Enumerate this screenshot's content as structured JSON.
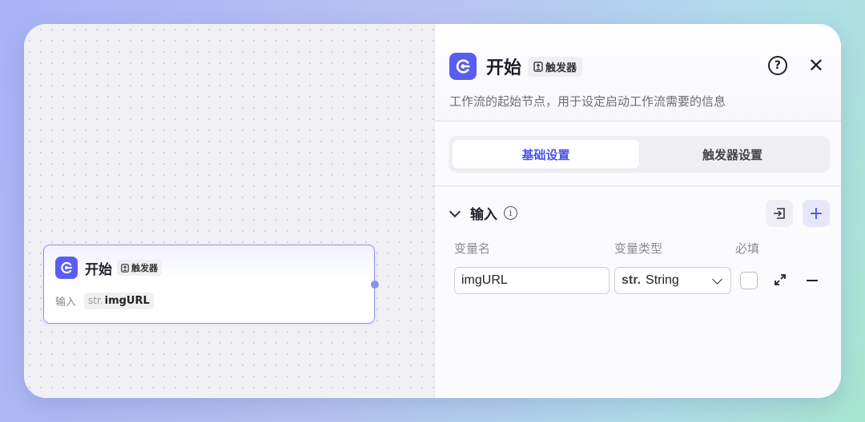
{
  "node": {
    "title": "开始",
    "trigger_tag": "触发器",
    "input_label": "输入",
    "var_prefix": "str.",
    "var_name": "imgURL"
  },
  "panel": {
    "title": "开始",
    "trigger_tag": "触发器",
    "help_icon": "question-circle-icon",
    "close_icon": "close-icon",
    "description": "工作流的起始节点，用于设定启动工作流需要的信息",
    "tabs": [
      {
        "label": "基础设置",
        "active": true
      },
      {
        "label": "触发器设置",
        "active": false
      }
    ],
    "input_section": {
      "title": "输入",
      "columns": [
        "变量名",
        "变量类型",
        "必填"
      ],
      "rows": [
        {
          "name": "imgURL",
          "type_prefix": "str.",
          "type": "String",
          "required": false
        }
      ]
    }
  },
  "colors": {
    "accent": "#5a5ef0",
    "tab_active": "#4b52e8"
  }
}
